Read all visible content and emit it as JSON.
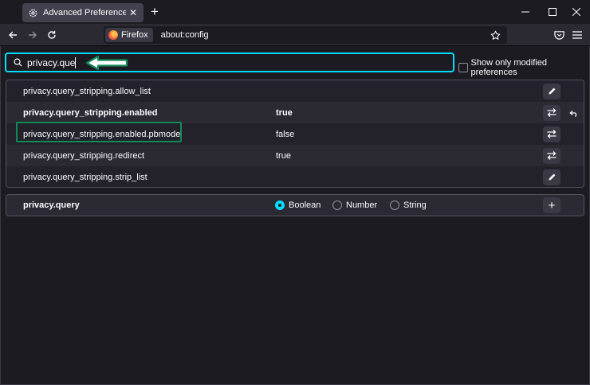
{
  "tab": {
    "title": "Advanced Preferences",
    "icon": "gear-icon",
    "close_icon": "close-icon"
  },
  "window_controls": [
    "minimize-icon",
    "maximize-icon",
    "close-icon"
  ],
  "nav": {
    "identity_label": "Firefox",
    "url": "about:config"
  },
  "search": {
    "value": "privacy.query",
    "show_modified_label": "Show only modified preferences",
    "show_modified_checked": false
  },
  "prefs": [
    {
      "name": "privacy.query_stripping.allow_list",
      "value": "",
      "modified": false,
      "action": "edit"
    },
    {
      "name": "privacy.query_stripping.enabled",
      "value": "true",
      "modified": true,
      "action": "toggle"
    },
    {
      "name": "privacy.query_stripping.enabled.pbmode",
      "value": "false",
      "modified": false,
      "action": "toggle"
    },
    {
      "name": "privacy.query_stripping.redirect",
      "value": "true",
      "modified": false,
      "action": "toggle"
    },
    {
      "name": "privacy.query_stripping.strip_list",
      "value": "",
      "modified": false,
      "action": "edit"
    }
  ],
  "new_pref": {
    "name": "privacy.query",
    "types": [
      "Boolean",
      "Number",
      "String"
    ],
    "selected_type": "Boolean"
  },
  "colors": {
    "accent": "#00ddff",
    "highlight_annotation": "#148a5a",
    "background": "#1c1b22"
  }
}
